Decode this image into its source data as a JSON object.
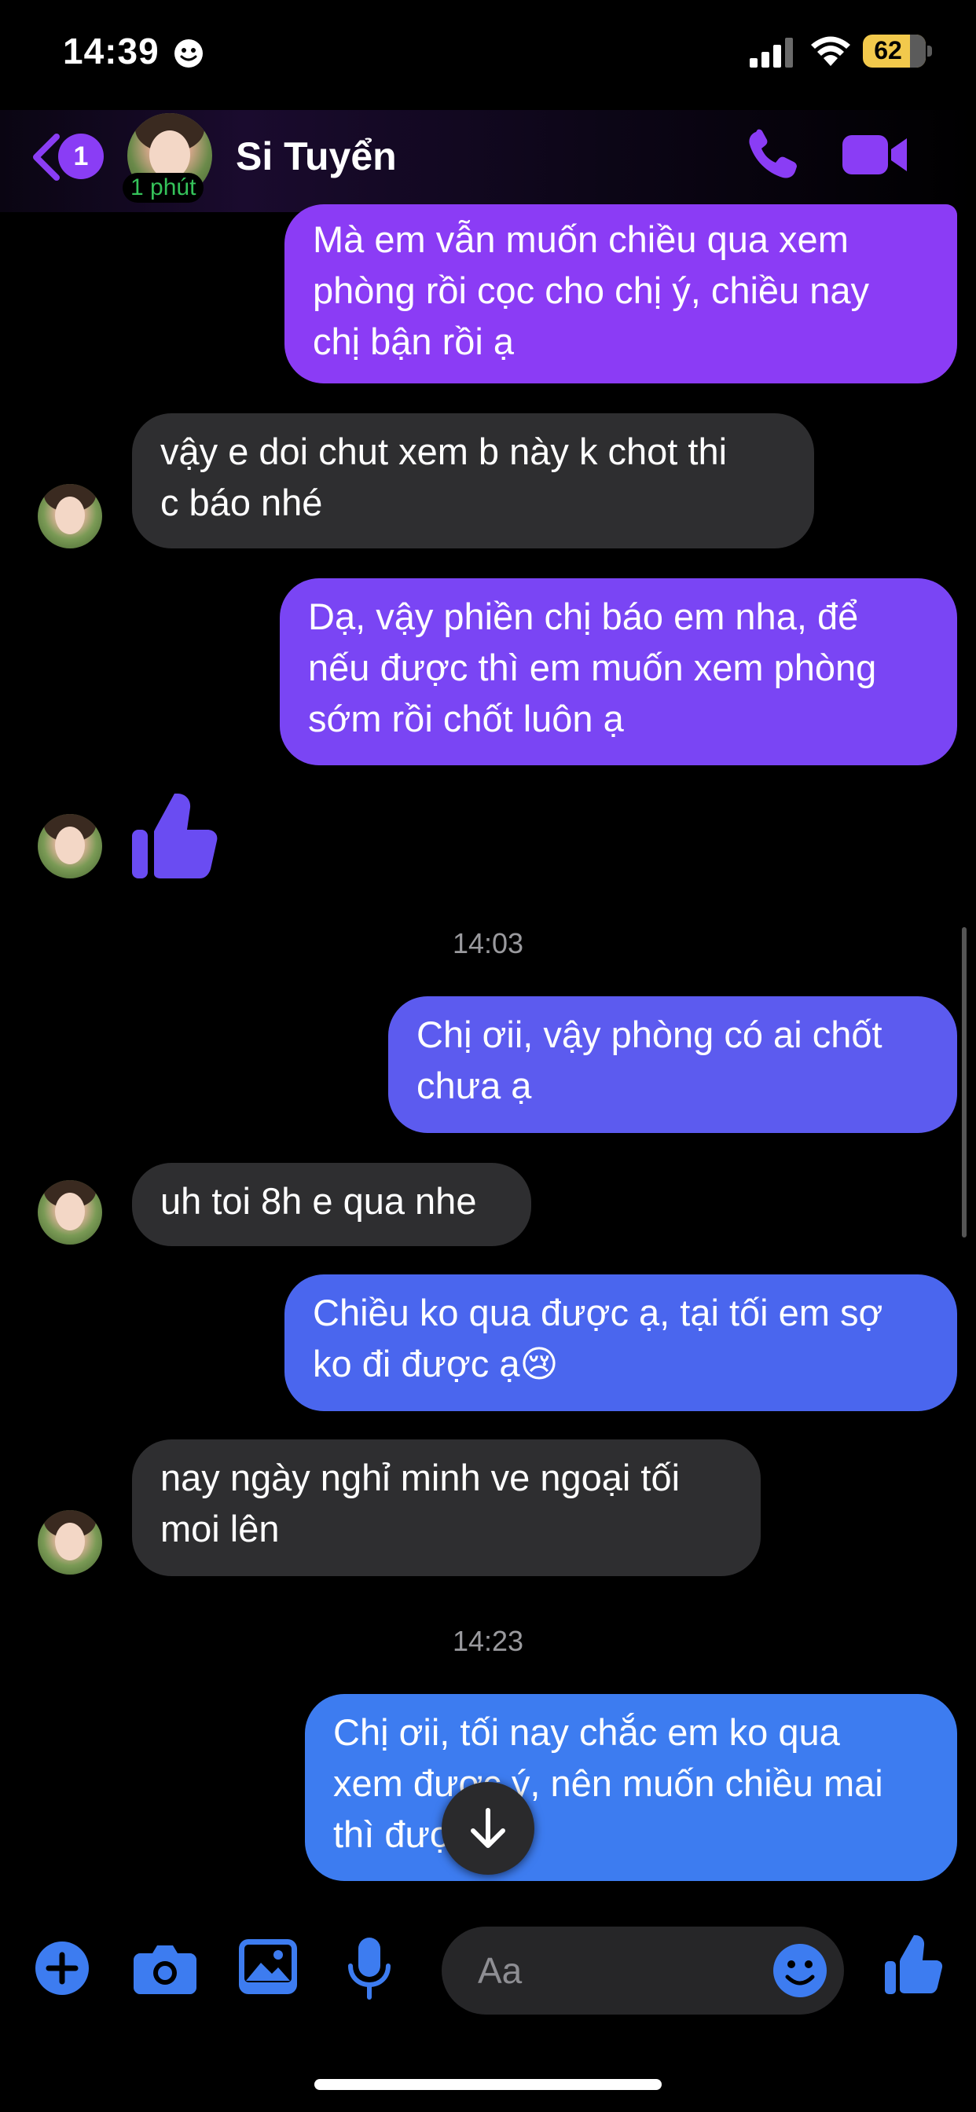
{
  "status_bar": {
    "time": "14:39",
    "battery": "62"
  },
  "header": {
    "back_badge": "1",
    "active_status": "1 phút",
    "contact_name": "Si Tuyển"
  },
  "messages": [
    {
      "sender": "me",
      "lines": [
        "Mà em vẫn muốn chiều qua xem",
        "phòng rồi cọc cho chị ý, chiều nay",
        "chị bận rồi ạ"
      ]
    },
    {
      "sender": "them",
      "lines": [
        "vậy e doi chut xem b này k chot thi",
        "c báo nhé"
      ]
    },
    {
      "sender": "me",
      "lines": [
        "Dạ, vậy phiền chị báo em nha, để",
        "nếu được thì em muốn xem phòng",
        "sớm rồi chốt luôn ạ"
      ]
    },
    {
      "sender": "them",
      "type": "like"
    },
    {
      "type": "timestamp",
      "text": "14:03"
    },
    {
      "sender": "me",
      "lines": [
        "Chị ơii, vậy phòng có ai chốt",
        "chưa ạ"
      ]
    },
    {
      "sender": "them",
      "lines": [
        "uh toi 8h e qua nhe"
      ]
    },
    {
      "sender": "me",
      "lines": [
        "Chiều ko qua được ạ, tại tối em sợ",
        "ko đi được ạ😢"
      ]
    },
    {
      "sender": "them",
      "lines": [
        "nay ngày nghỉ minh ve ngoại tối",
        "moi lên"
      ]
    },
    {
      "type": "timestamp",
      "text": "14:23"
    },
    {
      "sender": "me",
      "lines": [
        "Chị ơii, tối nay chắc em ko qua",
        "xem được ý, nên muốn chiều mai",
        "thì được ạ"
      ]
    }
  ],
  "composer": {
    "placeholder": "Aa"
  },
  "colors": {
    "accent_purple": "#8a3df5",
    "bubble_me_top": "#8b3cf5",
    "bubble_me_bottom": "#3d7cf0",
    "bubble_them": "#2e2e30",
    "active_green": "#35c35a"
  }
}
